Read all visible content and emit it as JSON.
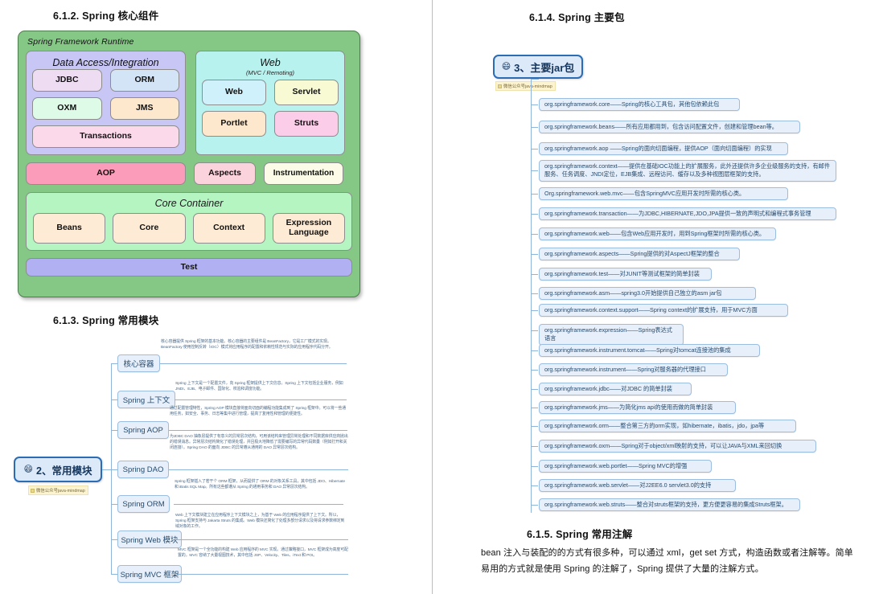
{
  "left": {
    "section_core_components": {
      "heading": "6.1.2. Spring 核心组件",
      "diagram": {
        "runtime_title": "Spring Framework Runtime",
        "data_access": {
          "title": "Data Access/Integration",
          "cells": [
            "JDBC",
            "ORM",
            "OXM",
            "JMS"
          ],
          "wide_cell": "Transactions"
        },
        "web": {
          "title": "Web",
          "subtitle": "(MVC / Remoting)",
          "cells": [
            "Web",
            "Servlet",
            "Portlet",
            "Struts"
          ]
        },
        "middle_row": [
          "AOP",
          "Aspects",
          "Instrumentation"
        ],
        "core_container": {
          "title": "Core Container",
          "cells": [
            "Beans",
            "Core",
            "Context",
            "Expression Language"
          ]
        },
        "test": "Test",
        "colors": {
          "runtime_bg": "#85c785",
          "data_access_bg": "#c7c6f4",
          "web_bg": "#b8f2ee",
          "core_container_bg": "#b4f5c2",
          "aop_bg": "#fb9dba",
          "test_bg": "#b0b0f2"
        }
      }
    },
    "section_common_modules": {
      "heading": "6.1.3. Spring 常用模块",
      "root_label": "2、常用模块",
      "root_emoji": "😄",
      "watermark": "微信公众号java-mindmap",
      "nodes": [
        {
          "label": "核心容器",
          "detail": "核心容器提供 Spring 框架的基本功能。核心容器的主要组件是 BeanFactory，它是工厂模式的实现。BeanFactory 使用控制反转（IOC）模式将应用程序的配置和依赖性规范与实际的应用程序代码分开。"
        },
        {
          "label": "Spring 上下文",
          "detail": "Spring 上下文是一个配置文件，向 Spring 框架提供上下文信息。Spring 上下文包括企业服务，例如 JNDI、EJB、电子邮件、国际化、校验和调度功能。"
        },
        {
          "label": "Spring AOP",
          "detail": "通过配置管理特性，Spring AOP 模块直接将面向切面的编程功能集成到了 Spring 框架中。可以将一些通用任务，如安全、事务、日志等集中进行管理，提高了复用性和管理的便捷性。"
        },
        {
          "label": "Spring DAO",
          "detail": "为JDBC DAO 抽象层提供了有意义的异常层次结构，可用该结构来管理异常处理和不同数据库供应商抛出的错误消息。异常层次结构简化了错误处理，并且极大地降低了需要编写的异常代码数量（例如打开和关闭连接）。Spring DAO 的面向 JDBC 的异常遵从通用的 DAO 异常层次结构。"
        },
        {
          "label": "Spring ORM",
          "detail": "Spring 框架插入了若干个 ORM 框架，从而提供了 ORM 的对象关系工具，其中包括 JDO、Hibernate 和 iBatis SQL Map。所有这些都遵从 Spring 的通用事务和 DAO 异常层次结构。"
        },
        {
          "label": "Spring Web 模块",
          "detail": "Web 上下文模块建立在应用程序上下文模块之上，为基于 Web 的应用程序提供了上下文。所以，Spring 框架支持与 Jakarta Struts 的集成。Web 模块还简化了处理多部分请求以及将请求参数绑定到域对象的工作。"
        },
        {
          "label": "Spring MVC 框架",
          "detail": "MVC 框架是一个全功能的构建 Web 应用程序的 MVC 实现。通过策略接口，MVC 框架成为高度可配置的。MVC 容纳了大量视图技术，其中包括 JSP、Velocity、Tiles、iText 和 POI。"
        }
      ]
    }
  },
  "right": {
    "section_main_packages": {
      "heading": "6.1.4. Spring 主要包",
      "root_label": "3、主要jar包",
      "root_emoji": "😄",
      "watermark": "微信公众号java-mindmap",
      "items": [
        "org.springframework.core——Spring的核心工具包，其他包依赖此包",
        "org.springframework.beans——所有应用都用到，包含访问配置文件，创建和管理bean等。",
        "org.springframework.aop ——Spring的面向切面编程，提供AOP（面向切面编程）的实现",
        "org.springframework.context——提供在基础IOC功能上的扩展服务，此外还提供许多企业级服务的支持，有邮件服务、任务调度、JNDI定位，EJB集成、远程访问、缓存以及多种视图层框架的支持。",
        "Org.springframework.web.mvc——包含SpringMVC应用开发时所需的核心类。",
        "org.springframework.transaction——为JDBC,HIBERNATE,JDO,JPA提供一致的声明式和编程式事务管理",
        "org.springframework.web——包含Web应用开发时，用到Spring框架时所需的核心类。",
        "org.springframework.aspects——Spring提供的对AspectJ框架的整合",
        "org.springframework.test——对JUNIT等测试框架的简单封装",
        "org.springframework.asm——spring3.0开始提供自己独立的asm jar包",
        "org.springframework.context.support——Spring context的扩展支持，用于MVC方面",
        "org.springframework.expression——Spring表达式语言",
        "org.springframework.instrument.tomcat——Spring对tomcat连接池的集成",
        "org.springframework.instrument——Spring对服务器的代理接口",
        "org.springframework.jdbc——对JDBC 的简单封装",
        "org.springframework.jms——为简化jms api的使用而做的简单封装",
        "org.springframework.orm——整合第三方的orm实现，如hibernate，ibatis，jdo，jpa等",
        "org.springframework.oxm——Spring对于object/xml映射的支持，可以让JAVA与XML来回切换",
        "org.springframework.web.portlet——Spring MVC的增强",
        "org.springframework.web.servlet——对J2EE6.0 servlet3.0的支持",
        "org.springframework.web.struts——整合对struts框架的支持，更方便更容易的集成Struts框架。"
      ]
    },
    "section_annotations": {
      "heading": "6.1.5. Spring 常用注解",
      "paragraph": "bean 注入与装配的的方式有很多种，可以通过 xml，get set 方式，构造函数或者注解等。简单易用的方式就是使用 Spring 的注解了，Spring 提供了大量的注解方式。"
    }
  }
}
